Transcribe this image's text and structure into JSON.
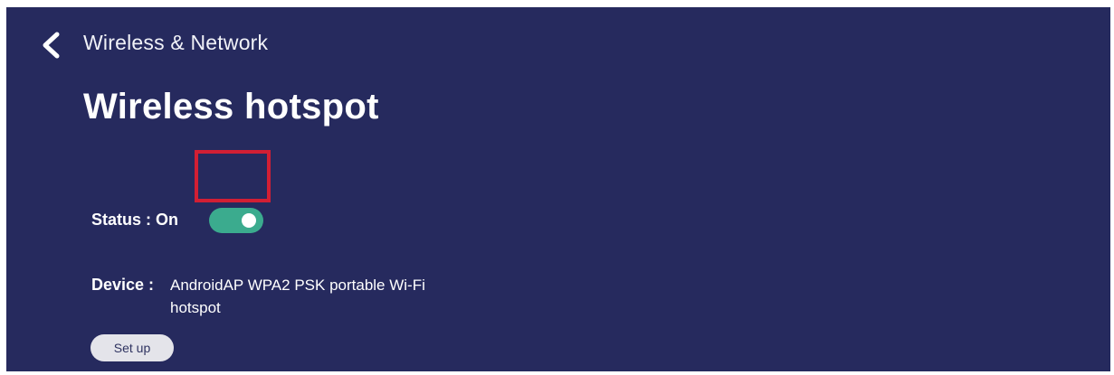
{
  "header": {
    "back_icon": "chevron-left-icon",
    "breadcrumb": "Wireless & Network"
  },
  "page": {
    "title": "Wireless hotspot"
  },
  "status": {
    "label": "Status : On",
    "enabled": true
  },
  "device": {
    "label": "Device :",
    "value": "AndroidAP WPA2 PSK portable Wi-Fi hotspot"
  },
  "actions": {
    "setup_label": "Set up"
  },
  "colors": {
    "background": "#262a5e",
    "toggle_on": "#3bab8e",
    "highlight": "#d21f34",
    "button_bg": "#e4e4ea"
  }
}
